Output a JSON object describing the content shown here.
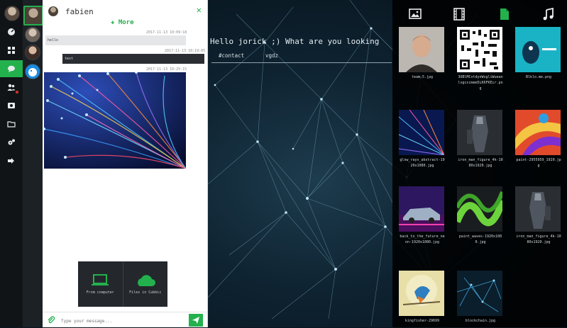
{
  "chat": {
    "contact_name": "fabien",
    "more_label": "More",
    "messages": [
      {
        "time": "2017-11-13 10:09:18",
        "text": "hello"
      },
      {
        "time": "2017-11-13 10:19:05",
        "text": "test"
      },
      {
        "time": "2017-11-13 10:25:15"
      }
    ],
    "upload_options": [
      {
        "label": "From computer",
        "icon": "laptop-icon"
      },
      {
        "label": "Files in Cubbic",
        "icon": "cloud-icon"
      }
    ],
    "input_placeholder": "Type your message..."
  },
  "main": {
    "greeting": "Hello jorick ;) What are you looking",
    "tags": [
      "#contact",
      "vgdz"
    ]
  },
  "media": {
    "tabs": [
      "image-icon",
      "film-icon",
      "document-icon",
      "music-icon"
    ],
    "active_tab": "document-icon",
    "files": [
      {
        "name": "team-5.jpg"
      },
      {
        "name": "3UBlMCvtdynWsgliWueanlvgcxcmem5LK6FKEcr.png"
      },
      {
        "name": "Blklo.me.png"
      },
      {
        "name": "glow_rays_abstract-1920x1080.jpg"
      },
      {
        "name": "iron_man_figure_4k-1080x1920.jpg"
      },
      {
        "name": "paint-2955959_1920.jpg"
      },
      {
        "name": "back_to_the_future_neon-1920x1080.jpg"
      },
      {
        "name": "paint_waves-1920x1080.jpg"
      },
      {
        "name": "iron_man_figure_4k-1080x1920.jpg"
      },
      {
        "name": "kingfisher-29699"
      },
      {
        "name": "blockchain.jpg"
      }
    ]
  },
  "colors": {
    "accent": "#23b14d",
    "sidebar": "#111417",
    "send": "#23b14d"
  }
}
